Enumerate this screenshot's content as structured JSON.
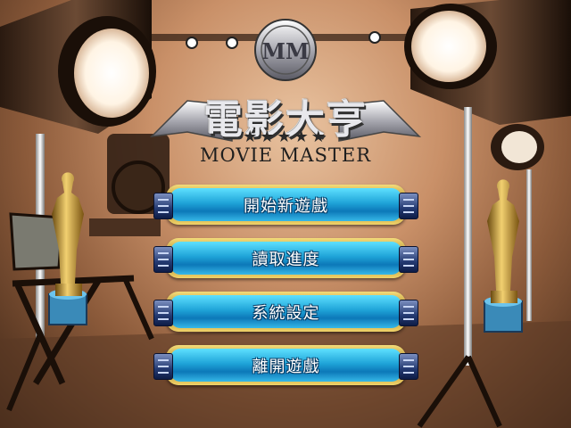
{
  "game": {
    "title_zh": "電影大亨",
    "title_en": "MOVIE MASTER",
    "rating_stars": "★★★★★",
    "emblem_monogram": "MM"
  },
  "menu": {
    "items": [
      {
        "label": "開始新遊戲"
      },
      {
        "label": "讀取進度"
      },
      {
        "label": "系統設定"
      },
      {
        "label": "離開遊戲"
      }
    ]
  },
  "colors": {
    "button_face": "#1fa4d8",
    "button_rim": "#d8b04a",
    "button_cap": "#243a72",
    "backdrop": "#c99068"
  }
}
